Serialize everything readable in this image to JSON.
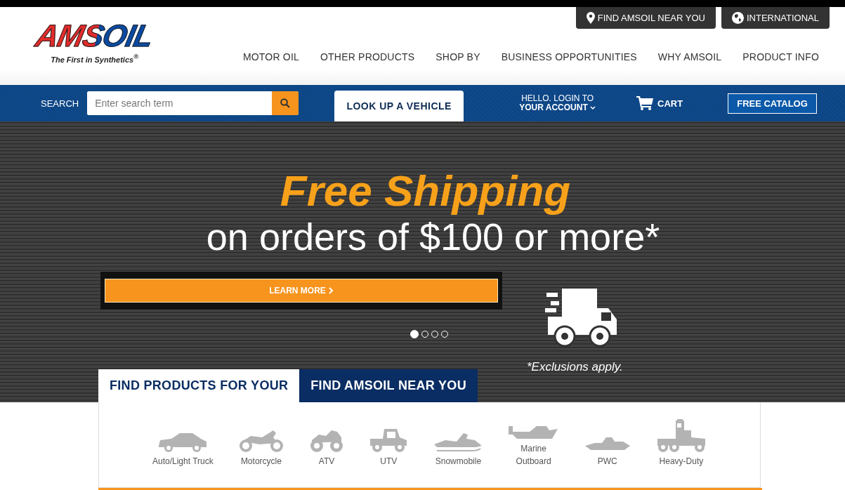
{
  "logo": {
    "wordmark": "AMSOIL",
    "tagline": "The First in Synthetics$^{®}$"
  },
  "utility_links": [
    {
      "kind": "location",
      "label": "FIND AMSOIL NEAR YOU"
    },
    {
      "kind": "region",
      "label": "INTERNATIONAL"
    }
  ],
  "main_nav": [
    "MOTOR OIL",
    "OTHER PRODUCTS",
    "SHOP BY",
    "BUSINESS OPPORTUNITIES",
    "WHY AMSOIL",
    "PRODUCT INFO"
  ],
  "search": {
    "label": "SEARCH",
    "placeholder": "Enter search term"
  },
  "vehicle_button": "LOOK UP A VEHICLE",
  "account": {
    "line_1": "HELLO. LOGIN TO",
    "line_2": "YOUR ACCOUNT"
  },
  "cart": "CART",
  "catalog_button": "FREE CATALOG",
  "hero": {
    "headline": "Free Shipping",
    "subline": "on orders of $100 or more*",
    "button": "LEARN MORE",
    "note": "*Exclusions apply.",
    "dots": [
      {
        "selected": true
      },
      {
        "selected": false
      },
      {
        "selected": false
      },
      {
        "selected": false
      }
    ]
  },
  "tabs": [
    {
      "label": "FIND PRODUCTS FOR YOUR",
      "selected": true
    },
    {
      "label": "FIND AMSOIL NEAR YOU",
      "selected": false
    }
  ],
  "vehicles": [
    {
      "kind": "car",
      "label": "Auto/Light Truck"
    },
    {
      "kind": "motorcycle",
      "label": "Motorcycle"
    },
    {
      "kind": "atv",
      "label": "ATV"
    },
    {
      "kind": "utv",
      "label": "UTV"
    },
    {
      "kind": "snowmobile",
      "label": "Snowmobile"
    },
    {
      "kind": "boat",
      "label": "Marine Outboard"
    },
    {
      "kind": "pwc",
      "label": "PWC"
    },
    {
      "kind": "truck",
      "label": "Heavy-Duty"
    }
  ]
}
